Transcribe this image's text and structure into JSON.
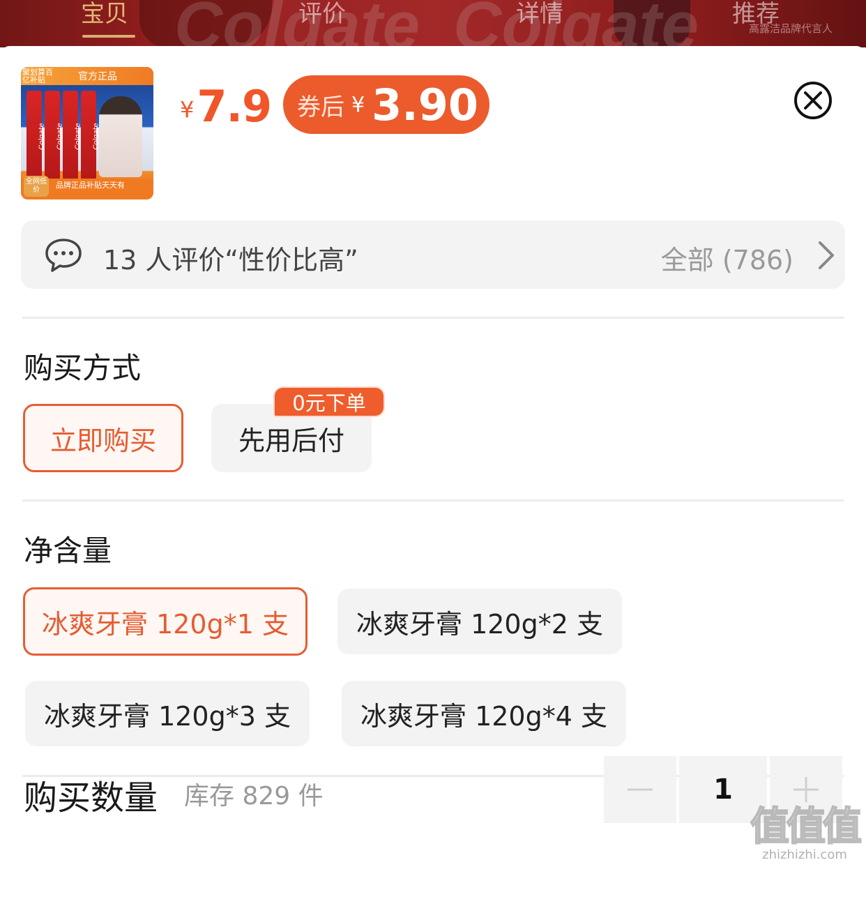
{
  "background_page": {
    "tabs": [
      "宝贝",
      "评价",
      "详情",
      "推荐"
    ],
    "active_tab": "宝贝",
    "caption": "高露洁品牌代言人",
    "brand_watermark": "Colgate"
  },
  "product": {
    "thumb_top_left": "聚划算百亿补贴",
    "thumb_official": "官方正品",
    "thumb_brand": "Colgate",
    "thumb_bottom": "品牌正品补贴天天有",
    "thumb_low_tag": "全网低价",
    "price_currency": "¥",
    "price": "7.9",
    "coupon_label": "券后",
    "coupon_currency": "¥",
    "coupon_price": "3.90"
  },
  "reviews": {
    "summary": "13 人评价“性价比高”",
    "all_label": "全部 (786)"
  },
  "purchase_method": {
    "title": "购买方式",
    "options": [
      {
        "label": "立即购买",
        "selected": true
      },
      {
        "label": "先用后付",
        "selected": false
      }
    ],
    "badge": "0元下单"
  },
  "net_content": {
    "title": "净含量",
    "options": [
      {
        "label": "冰爽牙膏 120g*1 支",
        "selected": true
      },
      {
        "label": "冰爽牙膏 120g*2 支",
        "selected": false
      },
      {
        "label": "冰爽牙膏 120g*3 支",
        "selected": false
      },
      {
        "label": "冰爽牙膏 120g*4 支",
        "selected": false
      }
    ]
  },
  "quantity": {
    "title": "购买数量",
    "stock": "库存 829 件",
    "value": "1"
  },
  "watermark": {
    "big": "值值值",
    "small": "zhizhizhi.com"
  },
  "colors": {
    "accent": "#ec5b2c",
    "selected_border": "#e65c32",
    "option_bg": "#f3f3f3"
  }
}
